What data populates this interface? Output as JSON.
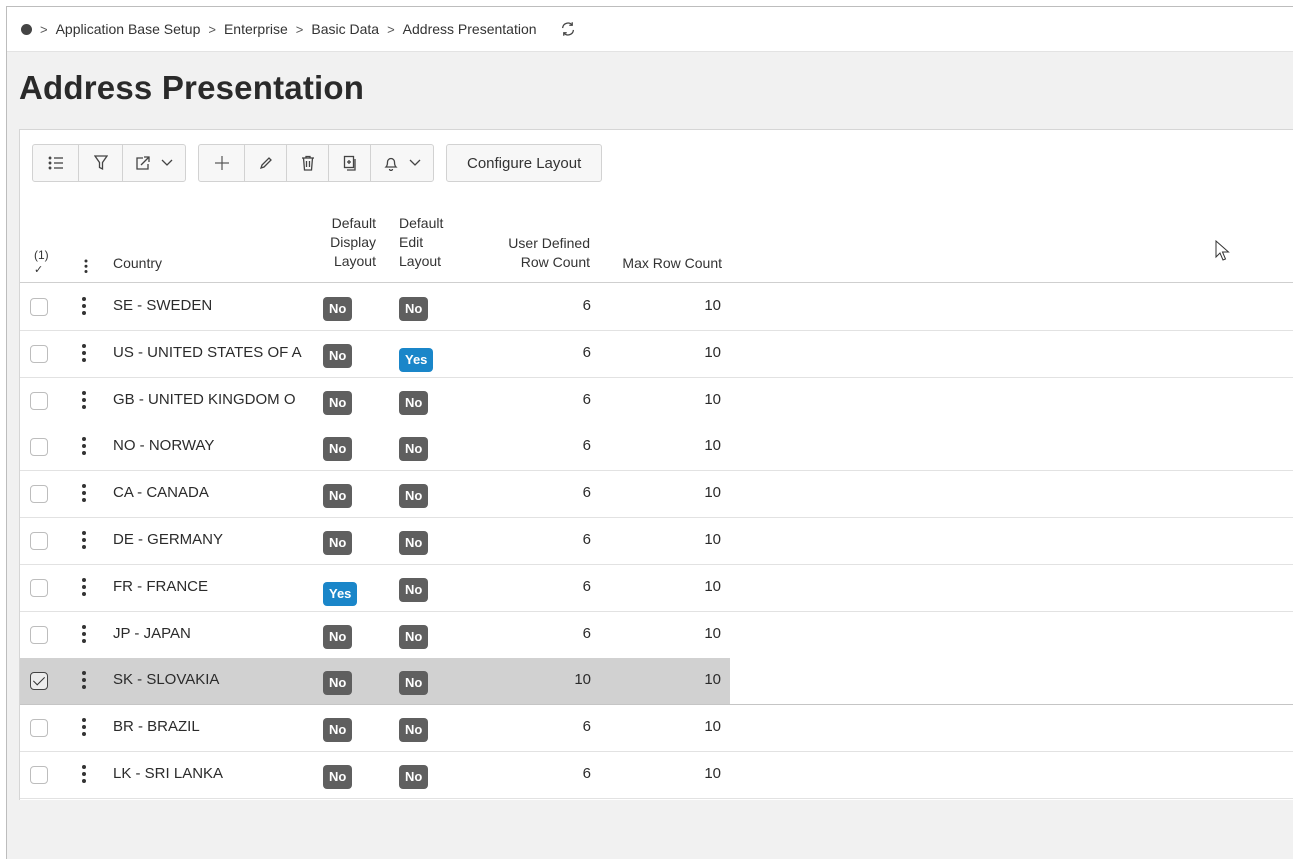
{
  "breadcrumb": [
    "Application Base Setup",
    "Enterprise",
    "Basic Data",
    "Address Presentation"
  ],
  "page_title": "Address Presentation",
  "toolbar": {
    "configure_label": "Configure Layout",
    "icons": [
      "list-icon",
      "filter-icon",
      "export-icon",
      "add-icon",
      "edit-icon",
      "delete-icon",
      "duplicate-icon",
      "notification-icon"
    ]
  },
  "table": {
    "selected_count": "(1)",
    "columns": {
      "country": "Country",
      "default_display_layout": [
        "Default",
        "Display",
        "Layout"
      ],
      "default_edit_layout": [
        "Default",
        "Edit",
        "Layout"
      ],
      "user_defined_row_count": [
        "User Defined",
        "Row Count"
      ],
      "max_row_count": "Max Row Count"
    },
    "rows": [
      {
        "country": "SE - SWEDEN",
        "display": "No",
        "edit": "No",
        "user_rows": "6",
        "max_rows": "10",
        "selected": false
      },
      {
        "country": "US - UNITED STATES OF A",
        "display": "No",
        "edit": "Yes",
        "user_rows": "6",
        "max_rows": "10",
        "selected": false
      },
      {
        "country": "GB - UNITED KINGDOM O",
        "display": "No",
        "edit": "No",
        "user_rows": "6",
        "max_rows": "10",
        "selected": false
      },
      {
        "country": "NO - NORWAY",
        "display": "No",
        "edit": "No",
        "user_rows": "6",
        "max_rows": "10",
        "selected": false
      },
      {
        "country": "CA - CANADA",
        "display": "No",
        "edit": "No",
        "user_rows": "6",
        "max_rows": "10",
        "selected": false
      },
      {
        "country": "DE - GERMANY",
        "display": "No",
        "edit": "No",
        "user_rows": "6",
        "max_rows": "10",
        "selected": false
      },
      {
        "country": "FR - FRANCE",
        "display": "Yes",
        "edit": "No",
        "user_rows": "6",
        "max_rows": "10",
        "selected": false
      },
      {
        "country": "JP - JAPAN",
        "display": "No",
        "edit": "No",
        "user_rows": "6",
        "max_rows": "10",
        "selected": false
      },
      {
        "country": "SK - SLOVAKIA",
        "display": "No",
        "edit": "No",
        "user_rows": "10",
        "max_rows": "10",
        "selected": true
      },
      {
        "country": "BR - BRAZIL",
        "display": "No",
        "edit": "No",
        "user_rows": "6",
        "max_rows": "10",
        "selected": false
      },
      {
        "country": "LK - SRI LANKA",
        "display": "No",
        "edit": "No",
        "user_rows": "6",
        "max_rows": "10",
        "selected": false
      }
    ]
  },
  "colors": {
    "yes_badge": "#1a86c9",
    "no_badge": "#5f5f5f",
    "selected_row": "#d1d1d1"
  }
}
